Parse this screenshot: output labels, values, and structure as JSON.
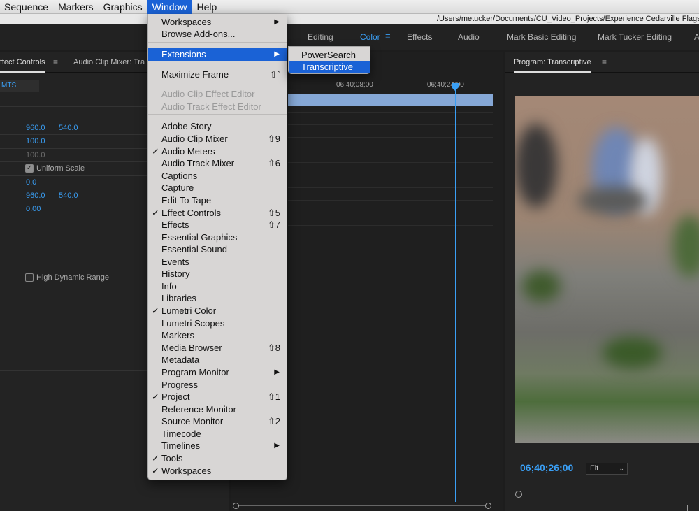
{
  "menubar": {
    "items": [
      "Sequence",
      "Markers",
      "Graphics",
      "Window",
      "Help"
    ],
    "active": "Window"
  },
  "title_path": "/Users/metucker/Documents/CU_Video_Projects/Experience Cedarville Flagsh",
  "workspaces": {
    "tabs": [
      "Editing",
      "Color",
      "Effects",
      "Audio",
      "Mark Basic Editing",
      "Mark Tucker Editing",
      "A"
    ],
    "active": "Color",
    "menu_icon": "hamburger-icon"
  },
  "left_panel": {
    "tabs": [
      "ffect Controls",
      "Audio Clip Mixer: Tra"
    ],
    "active_tab": "ffect Controls",
    "sub_tab": "MTS",
    "rows": {
      "position_x": "960.0",
      "position_y": "540.0",
      "scale": "100.0",
      "scale_width": "100.0",
      "uniform_scale_label": "Uniform Scale",
      "rotation": "0.0",
      "anchor_x": "960.0",
      "anchor_y": "540.0",
      "anti_flicker": "0.00",
      "hdr_label": "High Dynamic Range"
    }
  },
  "timeline": {
    "ruler_labels": [
      "06;40;08;00",
      "06;40;24;00"
    ]
  },
  "program": {
    "title": "Program: Transcriptive",
    "timecode": "06;40;26;00",
    "fit": "Fit"
  },
  "window_menu": {
    "items": [
      {
        "label": "Workspaces",
        "submenu": true
      },
      {
        "label": "Browse Add-ons..."
      },
      {
        "label": "Extensions",
        "submenu": true,
        "highlight": true
      },
      {
        "label": "Maximize Frame",
        "shortcut": "⇧`"
      },
      {
        "label": "Audio Clip Effect Editor",
        "disabled": true
      },
      {
        "label": "Audio Track Effect Editor",
        "disabled": true
      },
      {
        "label": "Adobe Story"
      },
      {
        "label": "Audio Clip Mixer",
        "shortcut": "⇧9"
      },
      {
        "label": "Audio Meters",
        "checked": true
      },
      {
        "label": "Audio Track Mixer",
        "shortcut": "⇧6"
      },
      {
        "label": "Captions"
      },
      {
        "label": "Capture"
      },
      {
        "label": "Edit To Tape"
      },
      {
        "label": "Effect Controls",
        "checked": true,
        "shortcut": "⇧5"
      },
      {
        "label": "Effects",
        "shortcut": "⇧7"
      },
      {
        "label": "Essential Graphics"
      },
      {
        "label": "Essential Sound"
      },
      {
        "label": "Events"
      },
      {
        "label": "History"
      },
      {
        "label": "Info"
      },
      {
        "label": "Libraries"
      },
      {
        "label": "Lumetri Color",
        "checked": true
      },
      {
        "label": "Lumetri Scopes"
      },
      {
        "label": "Markers"
      },
      {
        "label": "Media Browser",
        "shortcut": "⇧8"
      },
      {
        "label": "Metadata"
      },
      {
        "label": "Program Monitor",
        "submenu": true
      },
      {
        "label": "Progress"
      },
      {
        "label": "Project",
        "checked": true,
        "shortcut": "⇧1"
      },
      {
        "label": "Reference Monitor"
      },
      {
        "label": "Source Monitor",
        "shortcut": "⇧2"
      },
      {
        "label": "Timecode"
      },
      {
        "label": "Timelines",
        "submenu": true
      },
      {
        "label": "Tools",
        "checked": true
      },
      {
        "label": "Workspaces",
        "checked": true
      }
    ],
    "check_glyph": "✓",
    "arrow_glyph": "▶"
  },
  "extensions_submenu": {
    "items": [
      {
        "label": "PowerSearch"
      },
      {
        "label": "Transcriptive",
        "highlight": true
      }
    ]
  },
  "colors": {
    "accent_blue": "#3a9ff5",
    "menu_highlight": "#1a62d6",
    "clip_color": "#86a8d6"
  }
}
